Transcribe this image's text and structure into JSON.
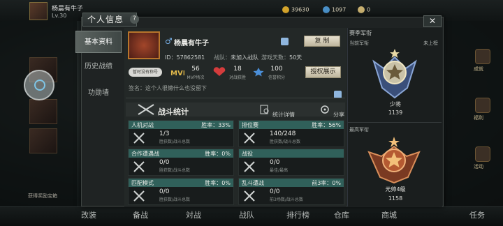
{
  "topbar": {
    "player_name": "杨晨有牛子",
    "level": "Lv.30",
    "resources": [
      {
        "value": "39630",
        "color": "#d5a52c",
        "icon": "gold-coin-icon"
      },
      {
        "value": "1097",
        "color": "#4a90c8",
        "icon": "diamond-icon"
      },
      {
        "value": "0",
        "color": "#c8b070",
        "icon": "ticket-icon"
      }
    ]
  },
  "modal": {
    "title": "个人信息",
    "help": "?",
    "close": "✕",
    "tabs": [
      {
        "label": "基本资料",
        "active": true
      },
      {
        "label": "历史战绩",
        "active": false
      },
      {
        "label": "功勋墙",
        "active": false
      }
    ]
  },
  "profile": {
    "gender_symbol": "♂",
    "name": "杨晨有牛子",
    "copy_label": "复 制",
    "id": "ID：57862581",
    "team_label": "战队：",
    "team_value": "未加入战队",
    "days_label": "游戏天数：",
    "days_value": "50天",
    "brand": "暂时没有称号",
    "mvp": {
      "value": "56",
      "label": "MVP场次"
    },
    "wins": {
      "value": "18",
      "label": "对战获胜"
    },
    "credit": {
      "value": "100",
      "label": "信誉积分"
    },
    "show_label": "授权展示",
    "signature": "签名：这个人很懒什么也没留下"
  },
  "stats": {
    "title": "战斗统计",
    "detail_label": "统计详情",
    "share_label": "分享",
    "cards": [
      {
        "name": "人机对战",
        "rate_label": "胜率：",
        "rate": "33%",
        "value": "1/3",
        "sub": "胜获数/战斗总数"
      },
      {
        "name": "排位赛",
        "rate_label": "胜率：",
        "rate": "56%",
        "value": "140/248",
        "sub": "胜获数/战斗总数"
      },
      {
        "name": "合作遭遇战",
        "rate_label": "胜率：",
        "rate": "0%",
        "value": "0/0",
        "sub": "胜获数/战斗总数"
      },
      {
        "name": "战役",
        "rate_label": "",
        "rate": "",
        "value": "0/0",
        "sub": "最佳/最高"
      },
      {
        "name": "匹配模式",
        "rate_label": "胜率：",
        "rate": "0%",
        "value": "0/0",
        "sub": "胜获数/战斗总数"
      },
      {
        "name": "乱斗遭战",
        "rate_label": "前3率：",
        "rate": "0%",
        "value": "0/0",
        "sub": "前3场数/战斗总数"
      }
    ]
  },
  "ranks": {
    "title": "赛季军衔",
    "current_label": "当前军衔",
    "current_status": "未上榜",
    "current_name": "少将",
    "current_points": "1139",
    "best_label": "最高军衔",
    "best_name": "元帅4级",
    "best_points": "1158"
  },
  "bottombar": [
    "改装",
    "备战",
    "対战",
    "战队",
    "排行榜",
    "仓库",
    "商城",
    "任务"
  ],
  "rightside": [
    "成就",
    "福利",
    "活动"
  ],
  "left_note": "获得奖励宝箱"
}
